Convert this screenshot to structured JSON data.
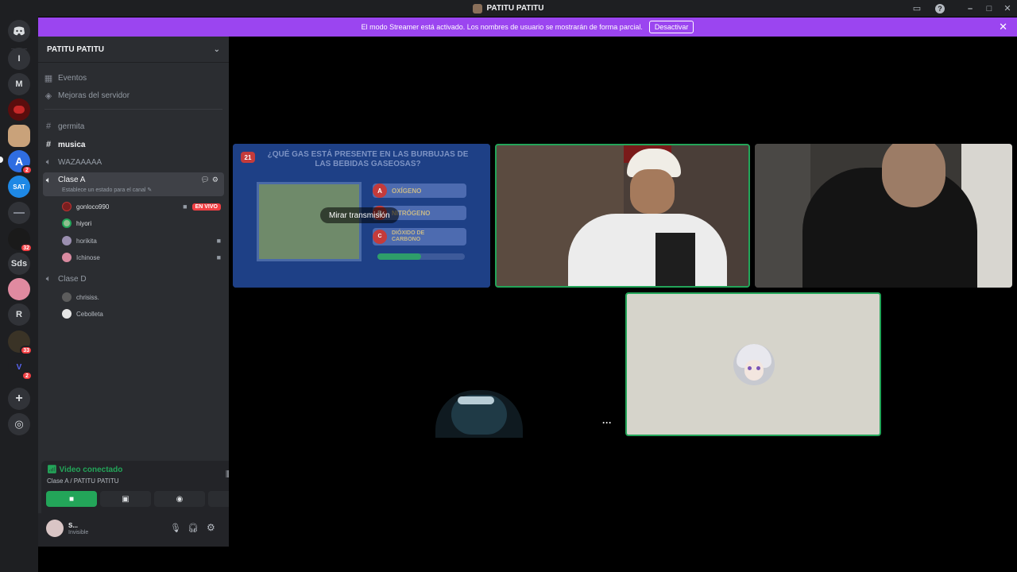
{
  "window": {
    "title": "PATITU PATITU"
  },
  "streamer_banner": {
    "text": "El modo Streamer está activado. Los nombres de usuario se mostrarán de forma parcial.",
    "button_label": "Desactivar"
  },
  "guilds": {
    "items": [
      {
        "label": "I"
      },
      {
        "label": "M"
      },
      {
        "label": "SAT"
      },
      {
        "label": "Sds"
      },
      {
        "label": "R"
      }
    ],
    "badges": [
      "2",
      "32",
      "33",
      "2"
    ]
  },
  "server": {
    "name": "PATITU PATITU"
  },
  "sidebar": {
    "events_label": "Eventos",
    "boosts_label": "Mejoras del servidor",
    "channels": [
      {
        "name": "germita"
      },
      {
        "name": "musica"
      },
      {
        "name": "WAZAAAAA"
      },
      {
        "name": "Clase A"
      },
      {
        "name": "Clase D"
      }
    ],
    "channel_status": "Establece un estado para el canal",
    "clase_a_users": [
      {
        "name": "gonloco990",
        "live": "EN VIVO"
      },
      {
        "name": "hiyori"
      },
      {
        "name": "horikita"
      },
      {
        "name": "Ichinose"
      }
    ],
    "clase_d_users": [
      {
        "name": "chrisiss."
      },
      {
        "name": "Cebolleta"
      }
    ]
  },
  "voice_panel": {
    "status": "Video conectado",
    "location": "Clase A / PATITU PATITU"
  },
  "account": {
    "name": "S...",
    "status": "Invisible"
  },
  "stage": {
    "watch_stream_label": "Mirar transmisión",
    "quiz": {
      "number": "21",
      "question": "¿QUÉ GAS ESTÁ PRESENTE EN LAS BURBUJAS DE LAS BEBIDAS GASEOSAS?",
      "options": [
        {
          "letter": "A",
          "text": "OXÍGENO"
        },
        {
          "letter": "B",
          "text": "NITRÓGENO"
        },
        {
          "letter": "C",
          "text": "DIÓXIDO DE CARBONO"
        }
      ]
    },
    "more_label": "···"
  },
  "colors": {
    "accent": "#9b45f0",
    "speaking": "#23a559",
    "live": "#f23f43"
  }
}
